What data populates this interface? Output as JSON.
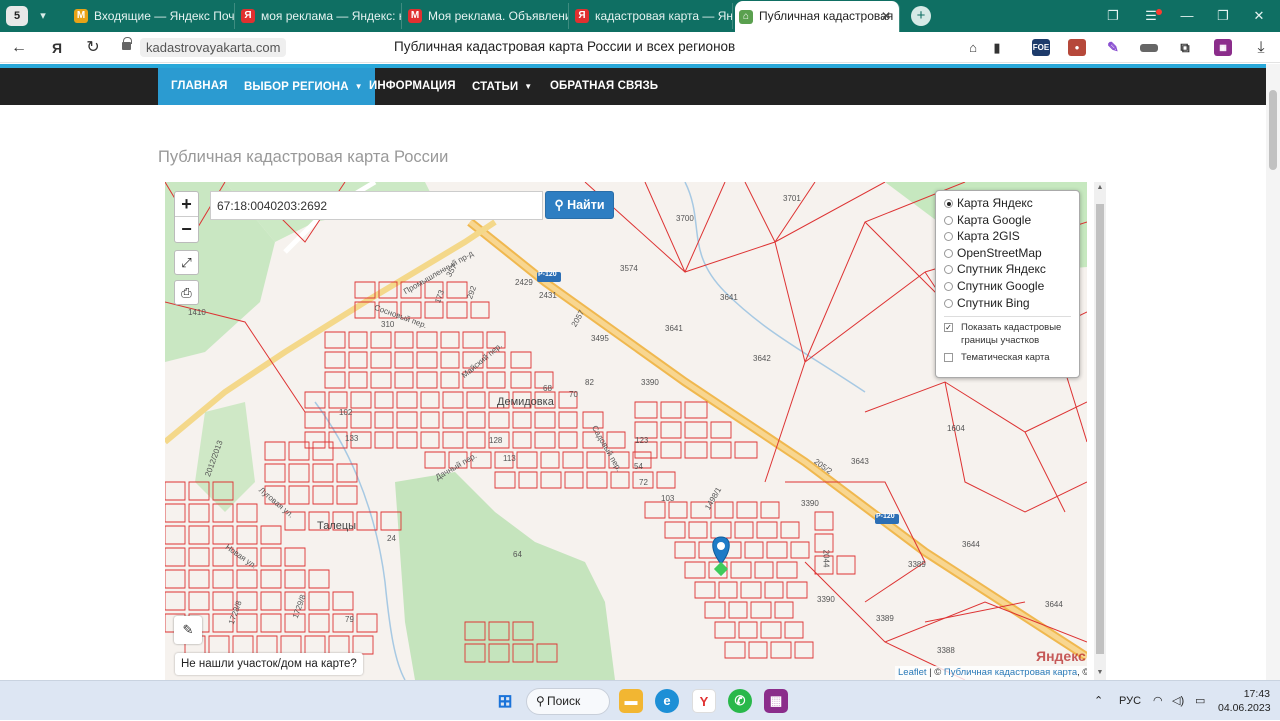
{
  "browser": {
    "tab_count": "5",
    "tabs": [
      {
        "label": "Входящие — Яндекс Почт",
        "fav": "M",
        "fav_color": "#e8a317",
        "active": false
      },
      {
        "label": "моя реклама — Яндекс: н",
        "fav": "Я",
        "fav_color": "#e03030",
        "active": false
      },
      {
        "label": "Моя реклама. Объявлени",
        "fav": "М",
        "fav_color": "#e03030",
        "active": false
      },
      {
        "label": "кадастровая карта — Янд",
        "fav": "Я",
        "fav_color": "#e03030",
        "active": false
      },
      {
        "label": "Публичная кадастровая",
        "fav": "⌂",
        "fav_color": "#5aa04f",
        "active": true
      }
    ],
    "url": "kadastrovayakarta.com",
    "page_title": "Публичная кадастровая карта России и всех регионов"
  },
  "nav": {
    "items": [
      {
        "label": "Главная",
        "active": true,
        "dropdown": false
      },
      {
        "label": "Выбор региона",
        "active": true,
        "dropdown": true
      },
      {
        "label": "Информация",
        "active": false,
        "dropdown": false
      },
      {
        "label": "Статьи",
        "active": false,
        "dropdown": true
      },
      {
        "label": "Обратная связь",
        "active": false,
        "dropdown": false
      }
    ]
  },
  "heading": "Публичная кадастровая карта России",
  "map": {
    "search_value": "67:18:0040203:2692",
    "search_button": "Найти",
    "layers": [
      {
        "label": "Карта Яндекс",
        "selected": true
      },
      {
        "label": "Карта Google",
        "selected": false
      },
      {
        "label": "Карта 2GIS",
        "selected": false
      },
      {
        "label": "OpenStreetMap",
        "selected": false
      },
      {
        "label": "Спутник Яндекс",
        "selected": false
      },
      {
        "label": "Спутник Google",
        "selected": false
      },
      {
        "label": "Спутник Bing",
        "selected": false
      }
    ],
    "show_borders_label": "Показать кадастровые границы участков",
    "show_borders_checked": true,
    "thematic_label": "Тематическая карта",
    "thematic_checked": false,
    "not_found": "Не нашли участок/дом на карте?",
    "attribution_leaflet": "Leaflet",
    "attribution_sep": " | © ",
    "attribution_link": "Публичная кадастровая карта",
    "attribution_tail": ", ©",
    "yandex_logo": "Яндекс",
    "town_label": "Демидовка",
    "village_label": "Талецы",
    "road_labels": [
      "Р-120",
      "Р-120",
      "205/2"
    ],
    "parcel_labels": [
      "3700",
      "3701",
      "3574",
      "3641",
      "3641",
      "3642",
      "3390",
      "3390",
      "3390",
      "3643",
      "1604",
      "3644",
      "3389",
      "3389",
      "3388",
      "3644",
      "1410",
      "310",
      "2057",
      "3495",
      "2431",
      "2429",
      "173",
      "357",
      "292",
      "133",
      "102",
      "1498/1",
      "2044",
      "2012/2013",
      "1729/8",
      "1728/8",
      "64",
      "79",
      "24",
      "82",
      "68",
      "70",
      "72",
      "54",
      "103",
      "123",
      "128",
      "113"
    ],
    "street_labels": [
      "Промышленный пр-д",
      "Сосновый пер.",
      "Майский пер.",
      "Дачный пер.",
      "Луговая ул.",
      "Садовый пер.",
      "Новая ул."
    ]
  },
  "taskbar": {
    "search_label": "Поиск",
    "lang": "РУС",
    "time": "17:43",
    "date": "04.06.2023"
  }
}
